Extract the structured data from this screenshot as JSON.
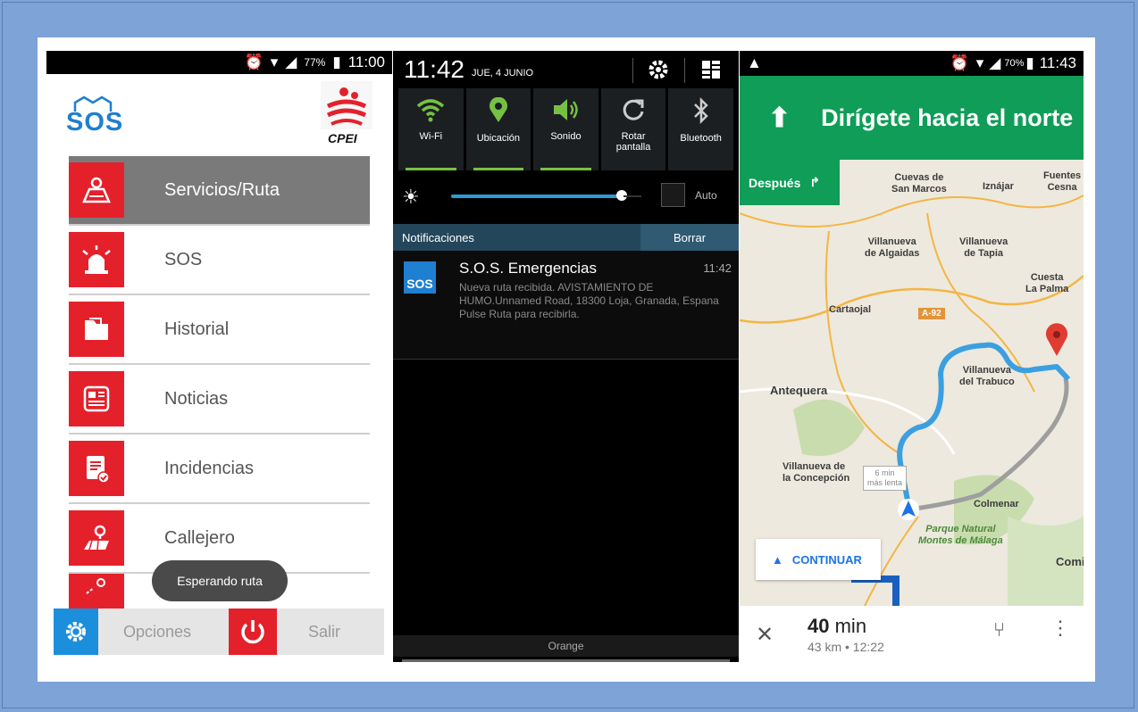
{
  "phone1": {
    "status": {
      "battery": "77%",
      "time": "11:00"
    },
    "logo_text": "SOS",
    "cpei_label": "CPEI",
    "menu": [
      {
        "label": "Servicios/Ruta",
        "icon": "map-route-icon",
        "active": true
      },
      {
        "label": "SOS",
        "icon": "siren-icon",
        "active": false
      },
      {
        "label": "Historial",
        "icon": "folder-icon",
        "active": false
      },
      {
        "label": "Noticias",
        "icon": "news-icon",
        "active": false
      },
      {
        "label": "Incidencias",
        "icon": "clipboard-check-icon",
        "active": false
      },
      {
        "label": "Callejero",
        "icon": "street-map-icon",
        "active": false
      }
    ],
    "toast": "Esperando ruta",
    "bottom": {
      "options_label": "Opciones",
      "exit_label": "Salir"
    }
  },
  "phone2": {
    "clock": "11:42",
    "date": "JUE, 4 JUNIO",
    "tiles": [
      {
        "label": "Wi-Fi",
        "icon": "wifi-icon"
      },
      {
        "label": "Ubicación",
        "icon": "location-pin-icon"
      },
      {
        "label": "Sonido",
        "icon": "speaker-icon"
      },
      {
        "label": "Rotar\npantalla",
        "icon": "rotate-icon"
      },
      {
        "label": "Bluetooth",
        "icon": "bluetooth-icon"
      }
    ],
    "auto_label": "Auto",
    "notif_header": "Notificaciones",
    "clear_label": "Borrar",
    "notification": {
      "app": "SOS",
      "title": "S.O.S. Emergencias",
      "time": "11:42",
      "body": "Nueva ruta recibida. AVISTAMIENTO DE HUMO.Unnamed Road, 18300 Loja, Granada, Espana Pulse Ruta para recibirla."
    },
    "carrier": "Orange"
  },
  "phone3": {
    "status": {
      "battery": "70%",
      "time": "11:43"
    },
    "instruction": "Dirígete hacia el norte",
    "despues": "Después",
    "places": {
      "cuevas": "Cuevas de\nSan Marcos",
      "iznajar": "Iznájar",
      "fuentes": "Fuentes\nCesna",
      "villanueva_algaidas": "Villanueva\nde Algaidas",
      "villanueva_tapia": "Villanueva\nde Tapia",
      "cuesta": "Cuesta\nLa Palma",
      "cartaojal": "Cartaojal",
      "road": "A-92",
      "villanueva_trabuco": "Villanueva\ndel Trabuco",
      "antequera": "Antequera",
      "villanueva_concepcion": "Villanueva de\nla Concepción",
      "colmenar": "Colmenar",
      "parque": "Parque Natural\nMontes de Málaga",
      "coma": "Comi",
      "more_time": "6 min\nmás lenta"
    },
    "continue_label": "CONTINUAR",
    "eta": {
      "time": "40",
      "unit": "min",
      "dist": "43 km • 12:22"
    }
  },
  "colors": {
    "red": "#e4212b",
    "blue": "#1c8fdc",
    "green": "#0f9d58",
    "route": "#3c9fe0"
  }
}
